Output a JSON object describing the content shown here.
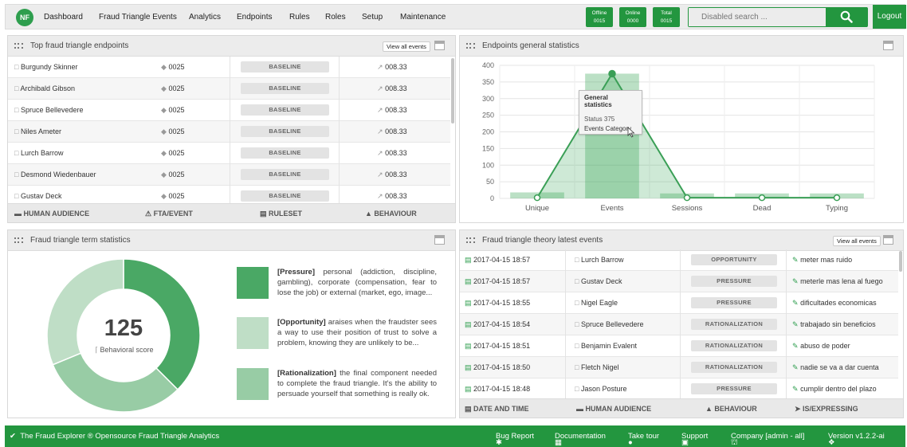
{
  "nav": {
    "logo": "NF",
    "items": [
      "Dashboard",
      "Fraud Triangle Events",
      "Analytics",
      "Endpoints",
      "Rules",
      "Roles",
      "Setup",
      "Maintenance"
    ],
    "badges": [
      {
        "label": "Offline",
        "value": "0015"
      },
      {
        "label": "Online",
        "value": "0000"
      },
      {
        "label": "Total",
        "value": "0015"
      }
    ],
    "search_placeholder": "Disabled search ...",
    "logout": "Logout"
  },
  "top_endpoints": {
    "title": "Top fraud triangle endpoints",
    "view_all": "View all events",
    "rows": [
      {
        "name": "Burgundy Skinner",
        "count": "0025",
        "ruleset": "BASELINE",
        "score": "008.33"
      },
      {
        "name": "Archibald Gibson",
        "count": "0025",
        "ruleset": "BASELINE",
        "score": "008.33"
      },
      {
        "name": "Spruce Bellevedere",
        "count": "0025",
        "ruleset": "BASELINE",
        "score": "008.33"
      },
      {
        "name": "Niles Ameter",
        "count": "0025",
        "ruleset": "BASELINE",
        "score": "008.33"
      },
      {
        "name": "Lurch Barrow",
        "count": "0025",
        "ruleset": "BASELINE",
        "score": "008.33"
      },
      {
        "name": "Desmond Wiedenbauer",
        "count": "0025",
        "ruleset": "BASELINE",
        "score": "008.33"
      },
      {
        "name": "Gustav Deck",
        "count": "0025",
        "ruleset": "BASELINE",
        "score": "008.33"
      }
    ],
    "footer": [
      "HUMAN AUDIENCE",
      "FTA/EVENT",
      "RULESET",
      "BEHAVIOUR"
    ]
  },
  "general_stats": {
    "title": "Endpoints general statistics",
    "tooltip": {
      "title": "General statistics",
      "line1": "Status 375",
      "line2": "Events Category"
    }
  },
  "chart_data": {
    "type": "area",
    "categories": [
      "Unique",
      "Events",
      "Sessions",
      "Dead",
      "Typing"
    ],
    "yticks": [
      0,
      50,
      100,
      150,
      200,
      250,
      300,
      350,
      400
    ],
    "ylim": [
      0,
      400
    ],
    "series": [
      {
        "type": "line",
        "values": [
          2,
          375,
          2,
          2,
          2
        ]
      },
      {
        "type": "bar",
        "values": [
          18,
          375,
          15,
          15,
          15
        ]
      }
    ],
    "grid": true,
    "color": "#3ca65a"
  },
  "term_stats": {
    "title": "Fraud triangle term statistics",
    "score": "125",
    "score_label": "Behavioral score",
    "donut": [
      {
        "name": "Pressure",
        "value": 30,
        "color": "#4aa865"
      },
      {
        "name": "Rationalization",
        "value": 25,
        "color": "#98cca5"
      },
      {
        "name": "Opportunity",
        "value": 25,
        "color": "#bfdec6"
      }
    ],
    "terms": [
      {
        "name": "[Pressure]",
        "text": "personal (addiction, discipline, gambling), corporate (compensation, fear to lose the job) or external (market, ego, image...",
        "color": "#4aa865"
      },
      {
        "name": "[Opportunity]",
        "text": "araises when the fraudster sees a way to use their position of trust to solve a problem, knowing they are unlikely to be...",
        "color": "#bfdec6"
      },
      {
        "name": "[Rationalization]",
        "text": "the final component needed to complete the fraud triangle. It's the ability to persuade yourself that something is really ok.",
        "color": "#98cca5"
      }
    ]
  },
  "latest_events": {
    "title": "Fraud triangle theory latest events",
    "view_all": "View all events",
    "rows": [
      {
        "date": "2017-04-15 18:57",
        "name": "Lurch Barrow",
        "behaviour": "OPPORTUNITY",
        "phrase": "meter mas ruido"
      },
      {
        "date": "2017-04-15 18:57",
        "name": "Gustav Deck",
        "behaviour": "PRESSURE",
        "phrase": "meterle mas lena al fuego"
      },
      {
        "date": "2017-04-15 18:55",
        "name": "Nigel Eagle",
        "behaviour": "PRESSURE",
        "phrase": "dificultades economicas"
      },
      {
        "date": "2017-04-15 18:54",
        "name": "Spruce Bellevedere",
        "behaviour": "RATIONALIZATION",
        "phrase": "trabajado sin beneficios"
      },
      {
        "date": "2017-04-15 18:51",
        "name": "Benjamin Evalent",
        "behaviour": "RATIONALIZATION",
        "phrase": "abuso de poder"
      },
      {
        "date": "2017-04-15 18:50",
        "name": "Fletch Nigel",
        "behaviour": "RATIONALIZATION",
        "phrase": "nadie se va a dar cuenta"
      },
      {
        "date": "2017-04-15 18:48",
        "name": "Jason Posture",
        "behaviour": "PRESSURE",
        "phrase": "cumplir dentro del plazo"
      }
    ],
    "footer": [
      "DATE AND TIME",
      "HUMAN AUDIENCE",
      "BEHAVIOUR",
      "IS/EXPRESSING"
    ]
  },
  "footer": {
    "brand": "The Fraud Explorer ® Opensource Fraud Triangle Analytics",
    "links": [
      "Bug Report",
      "Documentation",
      "Take tour",
      "Support",
      "Company [admin - all]",
      "Version v1.2.2-ai"
    ]
  }
}
